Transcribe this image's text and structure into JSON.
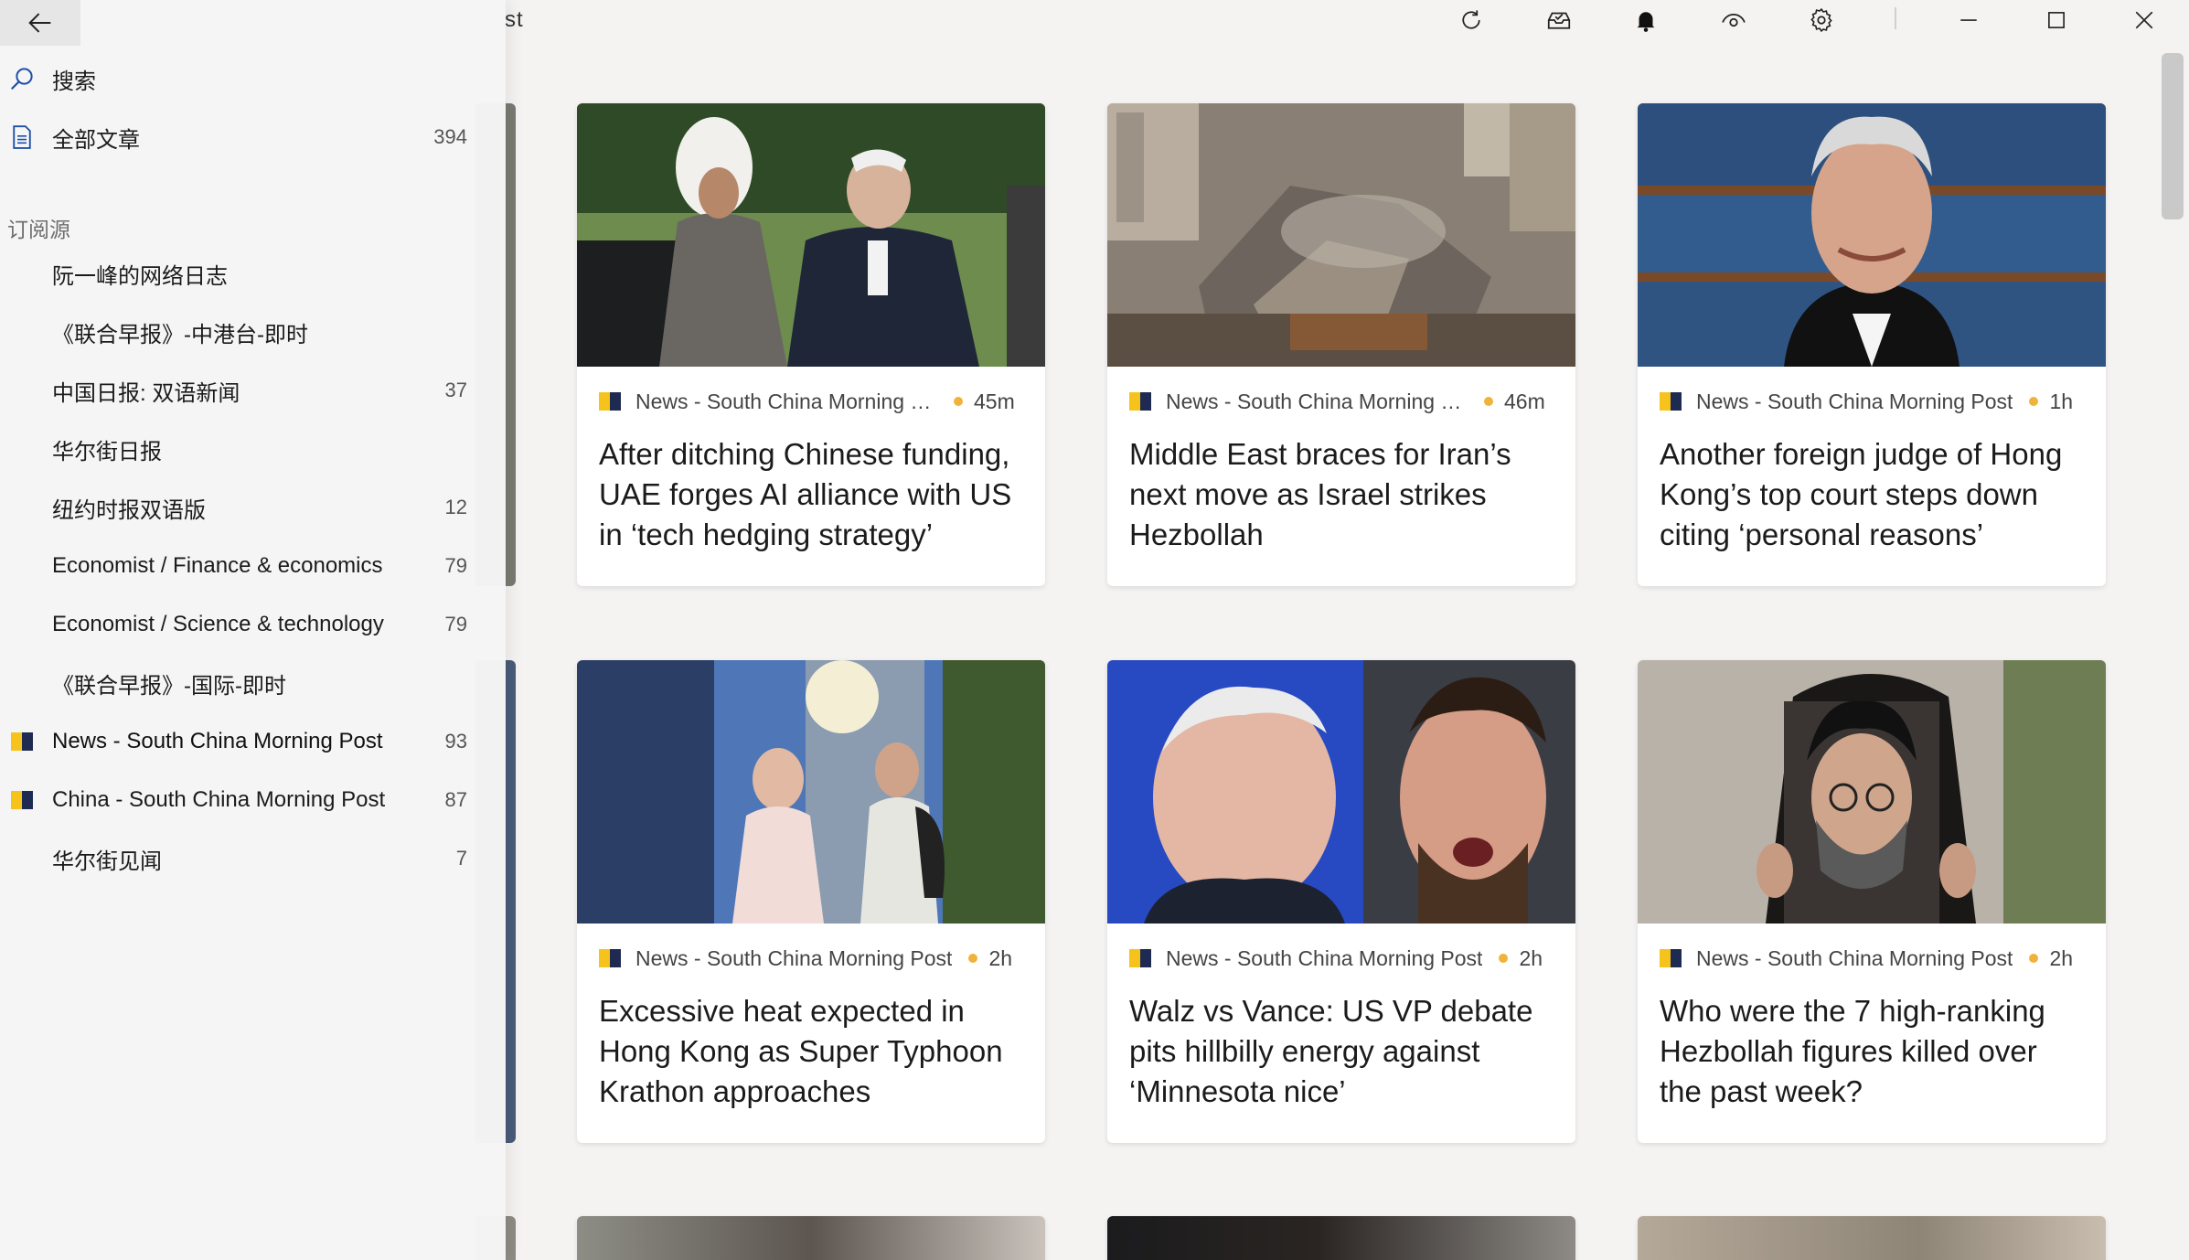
{
  "window": {
    "partial_title": "st",
    "toolbar": {
      "refresh_icon": "refresh-icon",
      "mark_all_read_icon": "inbox-check-icon",
      "notification_icon": "bell-icon",
      "view_icon": "eye-icon",
      "settings_icon": "gear-icon"
    },
    "controls": [
      "minimize",
      "maximize",
      "close"
    ]
  },
  "pane": {
    "back_icon": "back-arrow-icon",
    "search_label": "搜索",
    "all_articles": {
      "label": "全部文章",
      "count": "394"
    },
    "section_label": "订阅源",
    "feeds": [
      {
        "label": "阮一峰的网络日志",
        "count": "",
        "logo": false
      },
      {
        "label": "《联合早报》-中港台-即时",
        "count": "",
        "logo": false
      },
      {
        "label": "中国日报: 双语新闻",
        "count": "37",
        "logo": false
      },
      {
        "label": "华尔街日报",
        "count": "",
        "logo": false
      },
      {
        "label": "纽约时报双语版",
        "count": "12",
        "logo": false
      },
      {
        "label": "Economist / Finance & economics",
        "count": "79",
        "logo": false
      },
      {
        "label": "Economist / Science & technology",
        "count": "79",
        "logo": false
      },
      {
        "label": "《联合早报》-国际-即时",
        "count": "",
        "logo": false
      },
      {
        "label": "News - South China Morning Post",
        "count": "93",
        "logo": true,
        "selected": true
      },
      {
        "label": "China - South China Morning Post",
        "count": "87",
        "logo": true
      },
      {
        "label": "华尔街见闻",
        "count": "7",
        "logo": false
      }
    ]
  },
  "cards": [
    {
      "source": "News - South China Morning Post",
      "age": "45m",
      "title": "After ditching Chinese funding, UAE forges AI alliance with US in ‘tech hedging strategy’",
      "image": "two-leaders-handshake"
    },
    {
      "source": "News - South China Morning Post",
      "age": "46m",
      "title": "Middle East braces for Iran’s next move as Israel strikes Hezbollah",
      "image": "collapsed-building-rubble"
    },
    {
      "source": "News - South China Morning Post",
      "age": "1h",
      "title": "Another foreign judge of Hong Kong’s top court steps down citing ‘personal reasons’",
      "image": "judge-portrait-bookshelf"
    },
    {
      "source": "News - South China Morning Post",
      "age": "2h",
      "title": "Excessive heat expected in Hong Kong as Super Typhoon Krathon approaches",
      "image": "pedestrians-skyscrapers-sun"
    },
    {
      "source": "News - South China Morning Post",
      "age": "2h",
      "title": "Walz vs Vance: US VP debate pits hillbilly energy against ‘Minnesota nice’",
      "image": "two-politicians-split"
    },
    {
      "source": "News - South China Morning Post",
      "age": "2h",
      "title": "Who were the 7 high-ranking Hezbollah figures killed over the past week?",
      "image": "portrait-held-up"
    }
  ],
  "colors": {
    "pane_bg": "#f6f5f5",
    "logo_yellow": "#f6c31c",
    "logo_navy": "#1e2a52",
    "age_dot": "#f0b33a"
  }
}
